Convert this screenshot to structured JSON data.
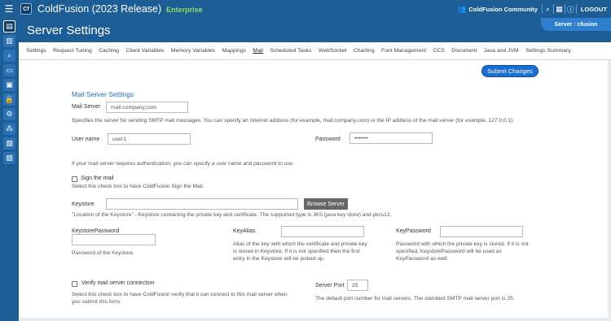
{
  "topbar": {
    "menu_icon": "hamburger-icon",
    "logo_text": "Cf",
    "title": "ColdFusion (2023 Release)",
    "edition": "Enterprise",
    "community_label": "ColdFusion Community",
    "logout_label": "LOGOUT"
  },
  "header": {
    "page_title": "Server Settings",
    "server_label": "Server : cfusion"
  },
  "nav": {
    "tabs": [
      "Settings",
      "Request Tuning",
      "Caching",
      "Client Variables",
      "Memory Variables",
      "Mappings",
      "Mail",
      "Scheduled Tasks",
      "WebSocket",
      "Charting",
      "Font Management",
      "CCS",
      "Document",
      "Java and JVM",
      "Settings Summary"
    ],
    "active": "Mail"
  },
  "form": {
    "submit_label": "Submit Changes",
    "section_title": "Mail Server Settings",
    "mail_server_label": "Mail Server",
    "mail_server_value": "mail.company.com",
    "mail_server_desc": "Specifies the server for sending SMTP mail messages. You can specify an Internet address (for example, mail.company.com) or the IP address of the mail server (for example, 127.0.0.1).",
    "username_label": "User name",
    "username_value": "user1",
    "password_label": "Password",
    "password_value": "•••••••",
    "auth_desc": "If your mail server requires authentication, you can specify a user name and password to use.",
    "sign_label": "Sign the mail",
    "sign_desc": "Select this check box to have ColdFusion Sign the Mail.",
    "keystore_label": "Keystore",
    "keystore_value": "",
    "browse_label": "Browse Server",
    "keystore_desc": "\"Location of the Keystore\" - Keystore containing the private key and certificate. The supported type is JKS (java key store) and pkcs12.",
    "keystore_password_label": "KeystorePassword",
    "keystore_password_desc": "Password of the Keystore.",
    "keyalias_label": "KeyAlias",
    "keyalias_desc_1": "Alias of the key with which the certificate and private key",
    "keyalias_desc_2": "is stored in Keystore. If it is not specified then the first",
    "keyalias_desc_3": "entry in the Keystore will be picked up.",
    "keypassword_label": "KeyPassword",
    "keypassword_desc_1": "Password with which the private key is stored. If it is not",
    "keypassword_desc_2": "specified, KeystorePassword will be used as",
    "keypassword_desc_3": "KeyPassword as well.",
    "verify_label": "Verify mail server connection",
    "verify_desc_1": "Select this check box to have ColdFusion verify that it can connect to this mail server when",
    "verify_desc_2": "you submit this form.",
    "server_port_label": "Server Port",
    "server_port_value": "25",
    "server_port_desc": "The default port number for mail servers. The standard SMTP mail server port is 25."
  },
  "rail_icons": [
    "server-settings-icon",
    "data-services-icon",
    "debugging-icon",
    "server-monitoring-icon",
    "event-gateways-icon",
    "security-icon",
    "packaging-icon",
    "enterprise-manager-icon",
    "security-analyzer-icon",
    "api-manager-icon"
  ]
}
